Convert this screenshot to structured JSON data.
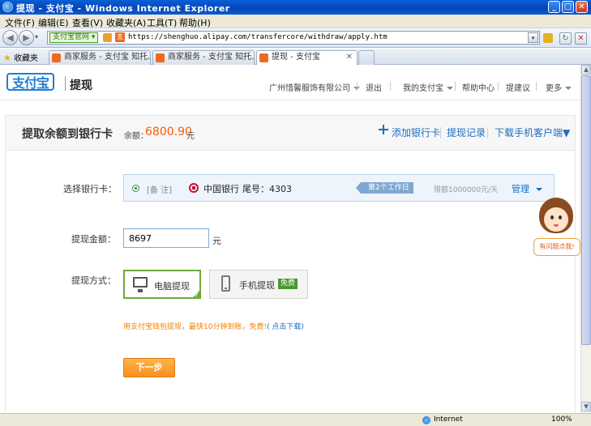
{
  "window": {
    "title": "提现 - 支付宝 - Windows Internet Explorer",
    "min": "_",
    "max": "□",
    "close": "✕"
  },
  "menu": [
    "文件(F)",
    "编辑(E)",
    "查看(V)",
    "收藏夹(A)",
    "工具(T)",
    "帮助(H)"
  ],
  "address": {
    "site_badge": "支付宝官网",
    "site_badge_arrow": "▾",
    "url": "https://shenghuo.alipay.com/transfercore/withdraw/apply.htm",
    "back_icon": "◀",
    "forward_icon": "▶",
    "dropdown_icon": "▾",
    "refresh_icon": "↻",
    "stop_icon": "✕"
  },
  "tabs": {
    "favorites": "收藏夹",
    "items": [
      {
        "label": "商家服务 - 支付宝 知托…"
      },
      {
        "label": "商家服务 - 支付宝 知托…"
      },
      {
        "label": "提现 - 支付宝",
        "close": "✕"
      }
    ]
  },
  "header": {
    "logo": "支付宝",
    "page_name": "提现",
    "nav": {
      "company": "广州惜馨服饰有限公司",
      "logout": "退出",
      "my_alipay": "我的支付宝",
      "help": "帮助中心",
      "suggest": "提建议",
      "more": "更多"
    }
  },
  "panel": {
    "title": "提取余额到银行卡",
    "balance_label": "余额：",
    "balance": "6800.90",
    "balance_unit": "元",
    "add_card": "添加银行卡",
    "records": "提现记录",
    "download": "下载手机客户端▼"
  },
  "form": {
    "card_label": "选择银行卡：",
    "remark": "[备 注]",
    "bank_name": "中国银行",
    "tail_no": "尾号：4303",
    "arrive": "第2个工作日",
    "limit": "限额1000000元/天",
    "manage": "管理",
    "amount_label": "提现金额：",
    "amount_value": "8697",
    "amount_unit": "元",
    "method_label": "提现方式：",
    "method_pc": "电脑提现",
    "method_mobile": "手机提现",
    "free": "免费",
    "promo_text": "用支付宝钱包提现，最快10分钟到账，免费!",
    "promo_link": "( 点击下载)",
    "next": "下一步"
  },
  "help_widget": {
    "text": "有问题点我!"
  },
  "status": {
    "zone": "Internet",
    "zoom": "100%"
  }
}
